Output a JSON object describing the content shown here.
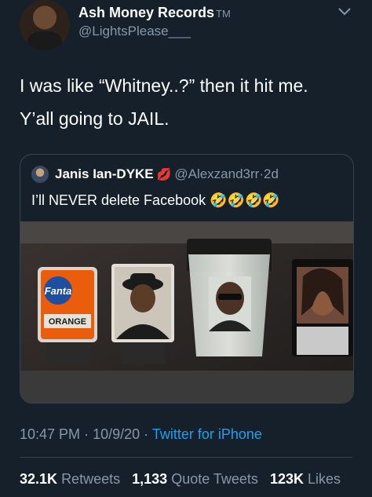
{
  "author": {
    "name": "Ash Money Records",
    "tm": "TM",
    "handle": "@LightsPlease___"
  },
  "tweet": {
    "line1": "I was like “Whitney..?” then it hit me.",
    "line2": "Y’all going to JAIL."
  },
  "quoted": {
    "name": "Janis Ian-DYKE",
    "emoji_after_name": "💋",
    "handle": "@Alexzand3rr",
    "separator": "·",
    "age": "2d",
    "text": "I’ll NEVER delete Facebook",
    "emojis": "🤣🤣🤣🤣",
    "photo": {
      "fanta_logo": "Fanta",
      "fanta_flavor": "ORANGE"
    }
  },
  "meta": {
    "time": "10:47 PM",
    "dot": "·",
    "date": "10/9/20",
    "dot2": "·",
    "source": "Twitter for iPhone"
  },
  "stats": {
    "retweets_count": "32.1K",
    "retweets_label": "Retweets",
    "quotes_count": "1,133",
    "quotes_label": "Quote Tweets",
    "likes_count": "123K",
    "likes_label": "Likes"
  },
  "colors": {
    "background": "#15202b",
    "secondary_text": "#8899a6",
    "accent": "#1da1f2",
    "border": "#38444d"
  },
  "icons": [
    "chevron-down-icon"
  ]
}
